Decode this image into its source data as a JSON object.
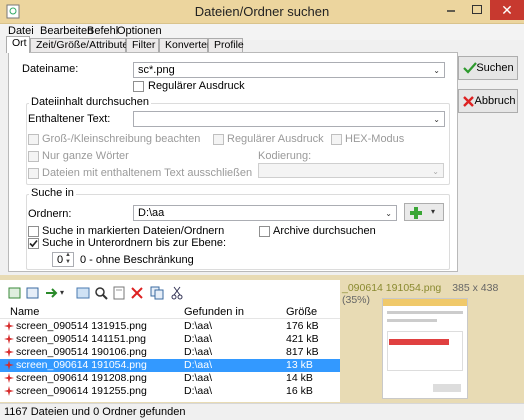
{
  "window": {
    "title": "Dateien/Ordner suchen"
  },
  "menu": [
    "Datei",
    "Bearbeiten",
    "Befehl",
    "Optionen"
  ],
  "tabs": [
    "Ort",
    "Zeit/Größe/Attribute",
    "Filter",
    "Konverter",
    "Profile"
  ],
  "form": {
    "filename_label": "Dateiname:",
    "filename_value": "sc*.png",
    "regex_label": "Regulärer Ausdruck",
    "content_group": "Dateiinhalt durchsuchen",
    "content_label": "Enthaltener Text:",
    "content_value": "",
    "case_label": "Groß-/Kleinschreibung beachten",
    "regex2_label": "Regulärer Ausdruck",
    "hex_label": "HEX-Modus",
    "whole_label": "Nur ganze Wörter",
    "encoding_label": "Kodierung:",
    "exclude_label": "Dateien mit enthaltenem Text ausschließen",
    "search_in_group": "Suche in",
    "folders_label": "Ordnern:",
    "folders_value": "D:\\aa",
    "marked_label": "Suche in markierten Dateien/Ordnern",
    "archives_label": "Archive durchsuchen",
    "subfolders_label": "Suche in Unterordnern bis zur Ebene:",
    "depth_value": "0",
    "depth_desc": "0 - ohne Beschränkung"
  },
  "buttons": {
    "search": "Suchen",
    "cancel": "Abbruch"
  },
  "results": {
    "headers": [
      "Name",
      "Gefunden in",
      "Größe"
    ],
    "rows": [
      {
        "name": "screen_090514 131915.png",
        "folder": "D:\\aa\\",
        "size": "176 kB"
      },
      {
        "name": "screen_090514 141151.png",
        "folder": "D:\\aa\\",
        "size": "421 kB"
      },
      {
        "name": "screen_090514 190106.png",
        "folder": "D:\\aa\\",
        "size": "817 kB"
      },
      {
        "name": "screen_090614 191054.png",
        "folder": "D:\\aa\\",
        "size": "13 kB"
      },
      {
        "name": "screen_090614 191208.png",
        "folder": "D:\\aa\\",
        "size": "14 kB"
      },
      {
        "name": "screen_090614 191255.png",
        "folder": "D:\\aa\\",
        "size": "16 kB"
      }
    ],
    "selected_index": 3
  },
  "preview": {
    "title": "_090614 191054.png",
    "dims": "385 x 438 (35%)"
  },
  "status": "1167 Dateien und 0 Ordner gefunden",
  "colors": {
    "accent": "#3399ff",
    "window_frame": "#ecd59e",
    "close": "#c7392f"
  }
}
